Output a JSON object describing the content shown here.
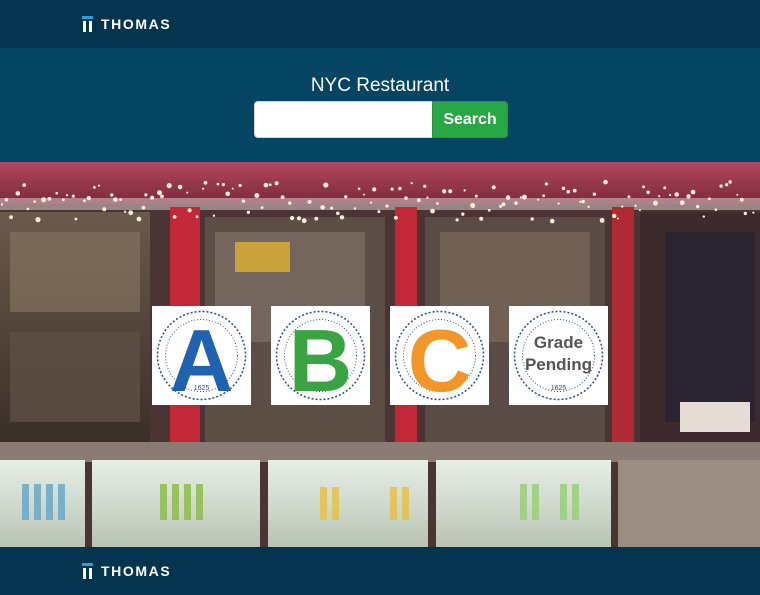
{
  "brand": {
    "logo_text": "THOMAS",
    "accent": "#2a9fd8"
  },
  "search": {
    "title": "NYC Restaurant",
    "input_value": "",
    "placeholder": "",
    "button_label": "Search",
    "button_color": "#28a745"
  },
  "grades": [
    {
      "letter": "A",
      "color": "#1f62b0",
      "seal_year": "1625"
    },
    {
      "letter": "B",
      "color": "#3aa342",
      "seal_year": "1625"
    },
    {
      "letter": "C",
      "color": "#f3962a",
      "seal_year": "1625"
    },
    {
      "line1": "Grade",
      "line2": "Pending",
      "color": "#555555",
      "seal_year": "1625"
    }
  ],
  "footer": {
    "logo_text": "THOMAS"
  },
  "colors": {
    "nav_bg": "#05344f",
    "search_bg": "#044563"
  }
}
